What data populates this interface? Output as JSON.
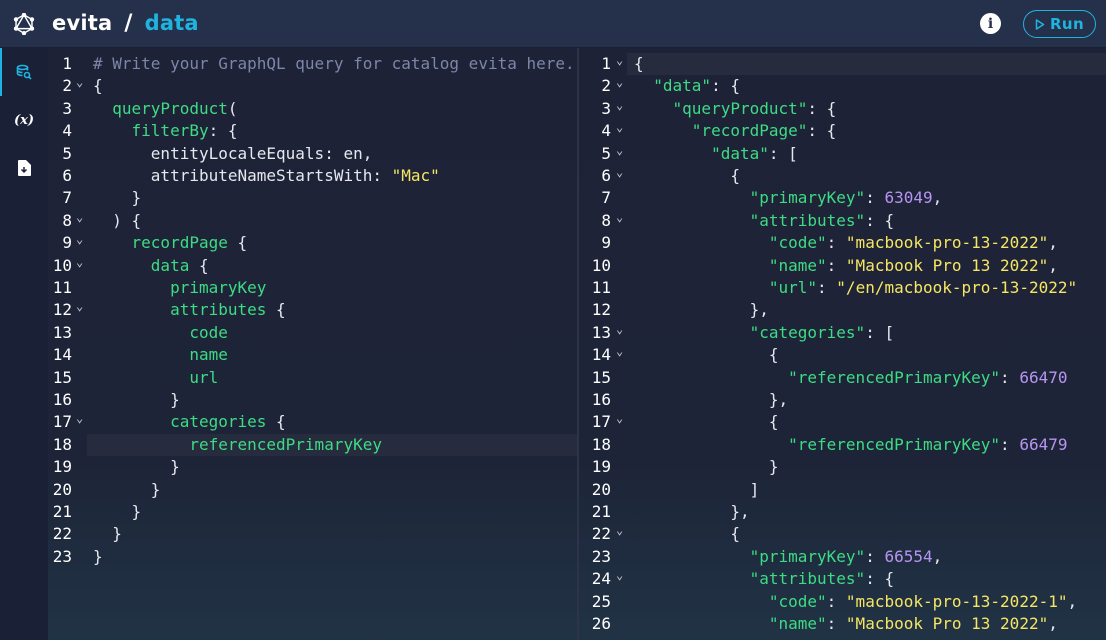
{
  "header": {
    "app_name": "evita",
    "separator": "/",
    "data_source": "data",
    "info_label": "i",
    "run_label": "Run"
  },
  "sidenav": {
    "items": [
      {
        "name": "query-editor",
        "icon": "search-database-icon"
      },
      {
        "name": "variables",
        "icon": "variables-icon",
        "label": "(x)"
      },
      {
        "name": "schema",
        "icon": "document-icon"
      }
    ]
  },
  "query_editor": {
    "lines": [
      {
        "n": "1",
        "fold": false,
        "tokens": [
          {
            "t": "# Write your GraphQL query for catalog evita here.",
            "c": "comment"
          }
        ]
      },
      {
        "n": "2",
        "fold": true,
        "tokens": [
          {
            "t": "{",
            "c": "punc"
          }
        ]
      },
      {
        "n": "3",
        "fold": false,
        "tokens": [
          {
            "t": "  ",
            "c": "punc"
          },
          {
            "t": "queryProduct",
            "c": "field"
          },
          {
            "t": "(",
            "c": "punc"
          }
        ]
      },
      {
        "n": "4",
        "fold": false,
        "tokens": [
          {
            "t": "    ",
            "c": "punc"
          },
          {
            "t": "filterBy",
            "c": "field"
          },
          {
            "t": ": {",
            "c": "punc"
          }
        ]
      },
      {
        "n": "5",
        "fold": false,
        "tokens": [
          {
            "t": "      entityLocaleEquals: en,",
            "c": "punc"
          }
        ]
      },
      {
        "n": "6",
        "fold": false,
        "tokens": [
          {
            "t": "      attributeNameStartsWith: ",
            "c": "punc"
          },
          {
            "t": "\"Mac\"",
            "c": "str"
          }
        ]
      },
      {
        "n": "7",
        "fold": false,
        "tokens": [
          {
            "t": "    }",
            "c": "punc"
          }
        ]
      },
      {
        "n": "8",
        "fold": true,
        "tokens": [
          {
            "t": "  ) {",
            "c": "punc"
          }
        ]
      },
      {
        "n": "9",
        "fold": true,
        "tokens": [
          {
            "t": "    ",
            "c": "punc"
          },
          {
            "t": "recordPage",
            "c": "field"
          },
          {
            "t": " {",
            "c": "punc"
          }
        ]
      },
      {
        "n": "10",
        "fold": true,
        "tokens": [
          {
            "t": "      ",
            "c": "punc"
          },
          {
            "t": "data",
            "c": "field"
          },
          {
            "t": " {",
            "c": "punc"
          }
        ]
      },
      {
        "n": "11",
        "fold": false,
        "tokens": [
          {
            "t": "        ",
            "c": "punc"
          },
          {
            "t": "primaryKey",
            "c": "field"
          }
        ]
      },
      {
        "n": "12",
        "fold": true,
        "tokens": [
          {
            "t": "        ",
            "c": "punc"
          },
          {
            "t": "attributes",
            "c": "field"
          },
          {
            "t": " {",
            "c": "punc"
          }
        ]
      },
      {
        "n": "13",
        "fold": false,
        "tokens": [
          {
            "t": "          ",
            "c": "punc"
          },
          {
            "t": "code",
            "c": "field"
          }
        ]
      },
      {
        "n": "14",
        "fold": false,
        "tokens": [
          {
            "t": "          ",
            "c": "punc"
          },
          {
            "t": "name",
            "c": "field"
          }
        ]
      },
      {
        "n": "15",
        "fold": false,
        "tokens": [
          {
            "t": "          ",
            "c": "punc"
          },
          {
            "t": "url",
            "c": "field"
          }
        ]
      },
      {
        "n": "16",
        "fold": false,
        "tokens": [
          {
            "t": "        }",
            "c": "punc"
          }
        ]
      },
      {
        "n": "17",
        "fold": true,
        "tokens": [
          {
            "t": "        ",
            "c": "punc"
          },
          {
            "t": "categories",
            "c": "field"
          },
          {
            "t": " {",
            "c": "punc"
          }
        ]
      },
      {
        "n": "18",
        "fold": false,
        "hl": true,
        "tokens": [
          {
            "t": "          ",
            "c": "punc"
          },
          {
            "t": "referencedPrimaryKey",
            "c": "field"
          }
        ]
      },
      {
        "n": "19",
        "fold": false,
        "tokens": [
          {
            "t": "        }",
            "c": "punc"
          }
        ]
      },
      {
        "n": "20",
        "fold": false,
        "tokens": [
          {
            "t": "      }",
            "c": "punc"
          }
        ]
      },
      {
        "n": "21",
        "fold": false,
        "tokens": [
          {
            "t": "    }",
            "c": "punc"
          }
        ]
      },
      {
        "n": "22",
        "fold": false,
        "tokens": [
          {
            "t": "  }",
            "c": "punc"
          }
        ]
      },
      {
        "n": "23",
        "fold": false,
        "tokens": [
          {
            "t": "}",
            "c": "punc"
          }
        ]
      }
    ]
  },
  "result_viewer": {
    "lines": [
      {
        "n": "1",
        "fold": true,
        "hl": true,
        "tokens": [
          {
            "t": "{",
            "c": "punc"
          }
        ]
      },
      {
        "n": "2",
        "fold": true,
        "tokens": [
          {
            "t": "  ",
            "c": "punc"
          },
          {
            "t": "\"data\"",
            "c": "key"
          },
          {
            "t": ": {",
            "c": "punc"
          }
        ]
      },
      {
        "n": "3",
        "fold": true,
        "tokens": [
          {
            "t": "    ",
            "c": "punc"
          },
          {
            "t": "\"queryProduct\"",
            "c": "key"
          },
          {
            "t": ": {",
            "c": "punc"
          }
        ]
      },
      {
        "n": "4",
        "fold": true,
        "tokens": [
          {
            "t": "      ",
            "c": "punc"
          },
          {
            "t": "\"recordPage\"",
            "c": "key"
          },
          {
            "t": ": {",
            "c": "punc"
          }
        ]
      },
      {
        "n": "5",
        "fold": true,
        "tokens": [
          {
            "t": "        ",
            "c": "punc"
          },
          {
            "t": "\"data\"",
            "c": "key"
          },
          {
            "t": ": [",
            "c": "punc"
          }
        ]
      },
      {
        "n": "6",
        "fold": true,
        "tokens": [
          {
            "t": "          {",
            "c": "punc"
          }
        ]
      },
      {
        "n": "7",
        "fold": false,
        "tokens": [
          {
            "t": "            ",
            "c": "punc"
          },
          {
            "t": "\"primaryKey\"",
            "c": "key"
          },
          {
            "t": ": ",
            "c": "punc"
          },
          {
            "t": "63049",
            "c": "num"
          },
          {
            "t": ",",
            "c": "punc"
          }
        ]
      },
      {
        "n": "8",
        "fold": true,
        "tokens": [
          {
            "t": "            ",
            "c": "punc"
          },
          {
            "t": "\"attributes\"",
            "c": "key"
          },
          {
            "t": ": {",
            "c": "punc"
          }
        ]
      },
      {
        "n": "9",
        "fold": false,
        "tokens": [
          {
            "t": "              ",
            "c": "punc"
          },
          {
            "t": "\"code\"",
            "c": "key"
          },
          {
            "t": ": ",
            "c": "punc"
          },
          {
            "t": "\"macbook-pro-13-2022\"",
            "c": "str"
          },
          {
            "t": ",",
            "c": "punc"
          }
        ]
      },
      {
        "n": "10",
        "fold": false,
        "tokens": [
          {
            "t": "              ",
            "c": "punc"
          },
          {
            "t": "\"name\"",
            "c": "key"
          },
          {
            "t": ": ",
            "c": "punc"
          },
          {
            "t": "\"Macbook Pro 13 2022\"",
            "c": "str"
          },
          {
            "t": ",",
            "c": "punc"
          }
        ]
      },
      {
        "n": "11",
        "fold": false,
        "tokens": [
          {
            "t": "              ",
            "c": "punc"
          },
          {
            "t": "\"url\"",
            "c": "key"
          },
          {
            "t": ": ",
            "c": "punc"
          },
          {
            "t": "\"/en/macbook-pro-13-2022\"",
            "c": "str"
          }
        ]
      },
      {
        "n": "12",
        "fold": false,
        "tokens": [
          {
            "t": "            },",
            "c": "punc"
          }
        ]
      },
      {
        "n": "13",
        "fold": true,
        "tokens": [
          {
            "t": "            ",
            "c": "punc"
          },
          {
            "t": "\"categories\"",
            "c": "key"
          },
          {
            "t": ": [",
            "c": "punc"
          }
        ]
      },
      {
        "n": "14",
        "fold": true,
        "tokens": [
          {
            "t": "              {",
            "c": "punc"
          }
        ]
      },
      {
        "n": "15",
        "fold": false,
        "tokens": [
          {
            "t": "                ",
            "c": "punc"
          },
          {
            "t": "\"referencedPrimaryKey\"",
            "c": "key"
          },
          {
            "t": ": ",
            "c": "punc"
          },
          {
            "t": "66470",
            "c": "num"
          }
        ]
      },
      {
        "n": "16",
        "fold": false,
        "tokens": [
          {
            "t": "              },",
            "c": "punc"
          }
        ]
      },
      {
        "n": "17",
        "fold": true,
        "tokens": [
          {
            "t": "              {",
            "c": "punc"
          }
        ]
      },
      {
        "n": "18",
        "fold": false,
        "tokens": [
          {
            "t": "                ",
            "c": "punc"
          },
          {
            "t": "\"referencedPrimaryKey\"",
            "c": "key"
          },
          {
            "t": ": ",
            "c": "punc"
          },
          {
            "t": "66479",
            "c": "num"
          }
        ]
      },
      {
        "n": "19",
        "fold": false,
        "tokens": [
          {
            "t": "              }",
            "c": "punc"
          }
        ]
      },
      {
        "n": "20",
        "fold": false,
        "tokens": [
          {
            "t": "            ]",
            "c": "punc"
          }
        ]
      },
      {
        "n": "21",
        "fold": false,
        "tokens": [
          {
            "t": "          },",
            "c": "punc"
          }
        ]
      },
      {
        "n": "22",
        "fold": true,
        "tokens": [
          {
            "t": "          {",
            "c": "punc"
          }
        ]
      },
      {
        "n": "23",
        "fold": false,
        "tokens": [
          {
            "t": "            ",
            "c": "punc"
          },
          {
            "t": "\"primaryKey\"",
            "c": "key"
          },
          {
            "t": ": ",
            "c": "punc"
          },
          {
            "t": "66554",
            "c": "num"
          },
          {
            "t": ",",
            "c": "punc"
          }
        ]
      },
      {
        "n": "24",
        "fold": true,
        "tokens": [
          {
            "t": "            ",
            "c": "punc"
          },
          {
            "t": "\"attributes\"",
            "c": "key"
          },
          {
            "t": ": {",
            "c": "punc"
          }
        ]
      },
      {
        "n": "25",
        "fold": false,
        "tokens": [
          {
            "t": "              ",
            "c": "punc"
          },
          {
            "t": "\"code\"",
            "c": "key"
          },
          {
            "t": ": ",
            "c": "punc"
          },
          {
            "t": "\"macbook-pro-13-2022-1\"",
            "c": "str"
          },
          {
            "t": ",",
            "c": "punc"
          }
        ]
      },
      {
        "n": "26",
        "fold": false,
        "tokens": [
          {
            "t": "              ",
            "c": "punc"
          },
          {
            "t": "\"name\"",
            "c": "key"
          },
          {
            "t": ": ",
            "c": "punc"
          },
          {
            "t": "\"Macbook Pro 13 2022\"",
            "c": "str"
          },
          {
            "t": ",",
            "c": "punc"
          }
        ]
      }
    ]
  },
  "colors": {
    "accent": "#20b3e0",
    "field": "#3ddc84",
    "string": "#f5e663",
    "number": "#b695f0",
    "comment": "#7c86a8"
  }
}
